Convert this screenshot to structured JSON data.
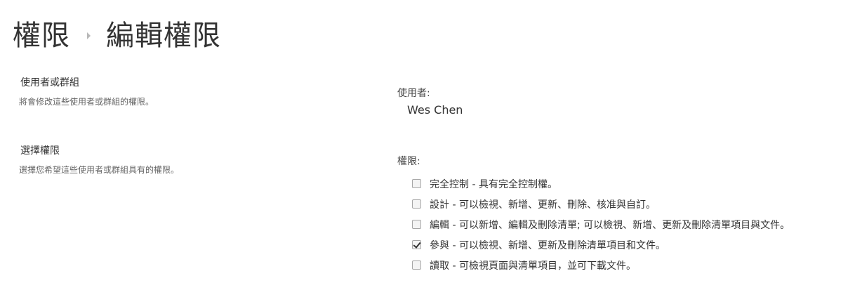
{
  "breadcrumb": {
    "parent": "權限",
    "current": "編輯權限"
  },
  "sections": {
    "users_or_groups": {
      "title": "使用者或群組",
      "description": "將會修改這些使用者或群組的權限。"
    },
    "choose_permissions": {
      "title": "選擇權限",
      "description": "選擇您希望這些使用者或群組具有的權限。"
    }
  },
  "users": {
    "label": "使用者:",
    "value": "Wes Chen"
  },
  "permissions": {
    "label": "權限:",
    "items": [
      {
        "label": "完全控制 - 具有完全控制權。",
        "checked": false
      },
      {
        "label": "設計 - 可以檢視、新增、更新、刪除、核准與自訂。",
        "checked": false
      },
      {
        "label": "編輯 - 可以新增、編輯及刪除清單; 可以檢視、新增、更新及刪除清單項目與文件。",
        "checked": false
      },
      {
        "label": "參與 - 可以檢視、新增、更新及刪除清單項目和文件。",
        "checked": true
      },
      {
        "label": "讀取 - 可檢視頁面與清單項目，並可下載文件。",
        "checked": false
      }
    ]
  }
}
